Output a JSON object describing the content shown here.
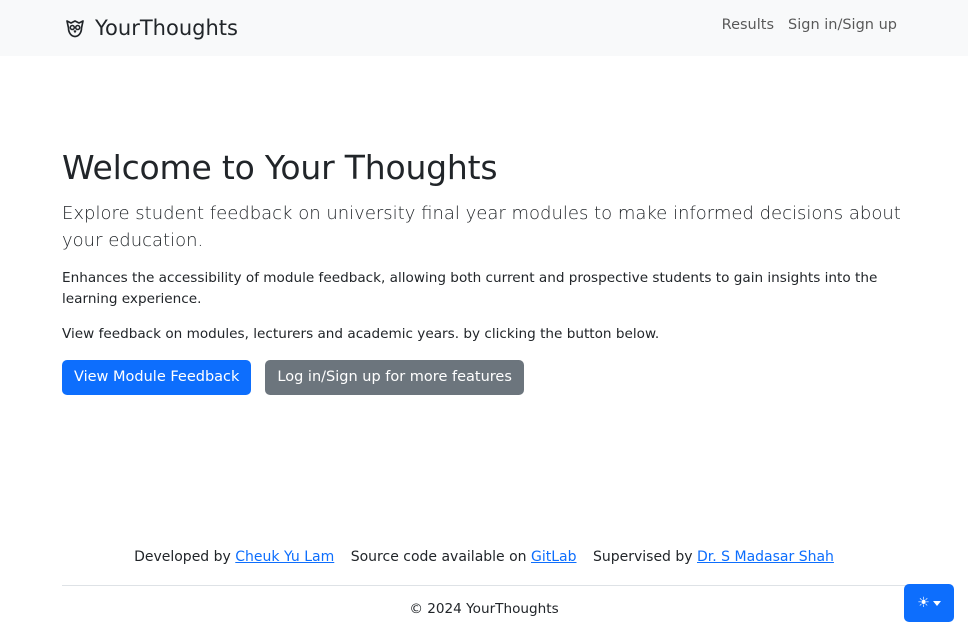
{
  "navbar": {
    "brand_icon": "owl-icon",
    "brand_name": "YourThoughts",
    "links": [
      "Results",
      "Sign in/Sign up"
    ]
  },
  "hero": {
    "title": "Welcome to Your Thoughts",
    "lead": "Explore student feedback on university final year modules to make informed decisions about your education.",
    "paragraph1": "Enhances the accessibility of module feedback, allowing both current and prospective students to gain insights into the learning experience.",
    "paragraph2": "View feedback on modules, lecturers and academic years. by clicking the button below.",
    "primary_button": "View Module Feedback",
    "secondary_button": "Log in/Sign up for more features"
  },
  "footer": {
    "developed_prefix": "Developed by",
    "developer_name": "Cheuk Yu Lam",
    "source_prefix": "Source code available on",
    "source_link": "GitLab",
    "supervised_prefix": "Supervised by",
    "supervisor_name": "Dr. S Madasar Shah",
    "copyright": "© 2024 YourThoughts"
  },
  "theme_toggle": {
    "icon": "sun-icon",
    "caret_icon": "caret-down-icon"
  },
  "colors": {
    "primary": "#0d6efd",
    "secondary": "#6c757d",
    "navbar_bg": "#f8f9fa"
  }
}
